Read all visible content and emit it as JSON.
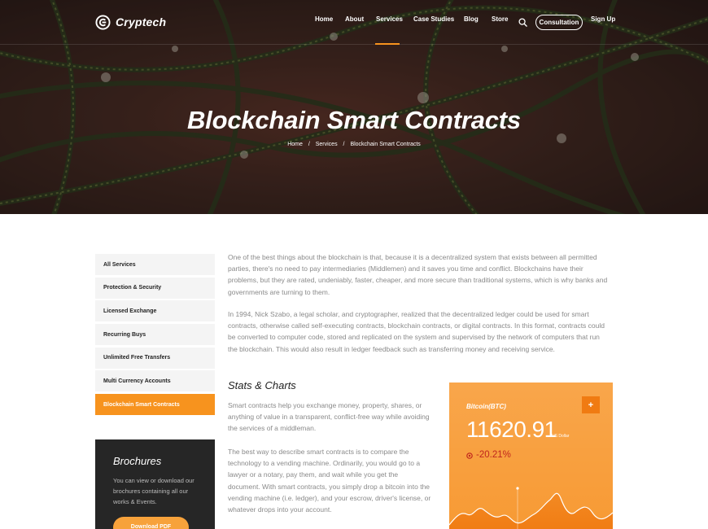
{
  "brand": {
    "name": "Cryptech",
    "logo_icon": "c-circle-logo-icon"
  },
  "nav": {
    "items": [
      "Home",
      "About",
      "Services",
      "Case Studies",
      "Blog",
      "Store"
    ],
    "active": "Services",
    "consultation_label": "Consultation",
    "signup_label": "Sign Up",
    "search_icon": "search-icon"
  },
  "hero": {
    "title": "Blockchain Smart Contracts",
    "breadcrumb": [
      "Home",
      "Services",
      "Blockchain Smart Contracts"
    ],
    "separator": "/"
  },
  "sidebar": {
    "items": [
      "All Services",
      "Protection & Security",
      "Licensed Exchange",
      "Recurring Buys",
      "Unlimited Free Transfers",
      "Multi Currency Accounts",
      "Blockchain Smart Contracts"
    ],
    "active": "Blockchain Smart Contracts"
  },
  "brochure": {
    "title": "Brochures",
    "text": "You can view or download our brochures containing all our works & Events.",
    "button_label": "Download PDF"
  },
  "content": {
    "paragraph1": "One of the best things about the blockchain is that, because it is a decentralized system that exists between all permitted parties, there's no need to pay intermediaries (Middlemen) and it saves you time and conflict. Blockchains have their problems, but they are rated, undeniably, faster, cheaper, and more secure than traditional systems, which is why banks and governments are turning to them.",
    "paragraph2": "In 1994, Nick Szabo, a legal scholar, and cryptographer, realized that the decentralized ledger could be used for smart contracts, otherwise called self-executing contracts, blockchain contracts, or digital contracts. In this format, contracts could be converted to computer code, stored and replicated on the system and supervised by the network of computers that run the blockchain. This would also result in ledger feedback such as transferring money and receiving service.",
    "stats_title": "Stats & Charts",
    "paragraph3": "Smart contracts help you exchange money, property, shares, or anything of value in a transparent, conflict-free way while avoiding the services of a middleman.",
    "paragraph4": "The best way to describe smart contracts is to compare the technology to a vending machine. Ordinarily, you would go to a lawyer or a notary, pay them, and wait while you get the document. With smart contracts, you simply drop a bitcoin into the vending machine (i.e. ledger), and your escrow, driver's license, or whatever drops into your account."
  },
  "btc_card": {
    "name": "Bitcoin(BTC)",
    "price": "11620.91",
    "unit": "US Dollar",
    "change": "-20.21%",
    "plus_label": "+",
    "colors": {
      "card": "#f79a34",
      "accent": "#f07b12",
      "negative": "#c0261d"
    }
  },
  "colors": {
    "accent": "#f7931e",
    "sidebar_bg": "#f4f4f4",
    "brochure_bg": "#262626"
  }
}
